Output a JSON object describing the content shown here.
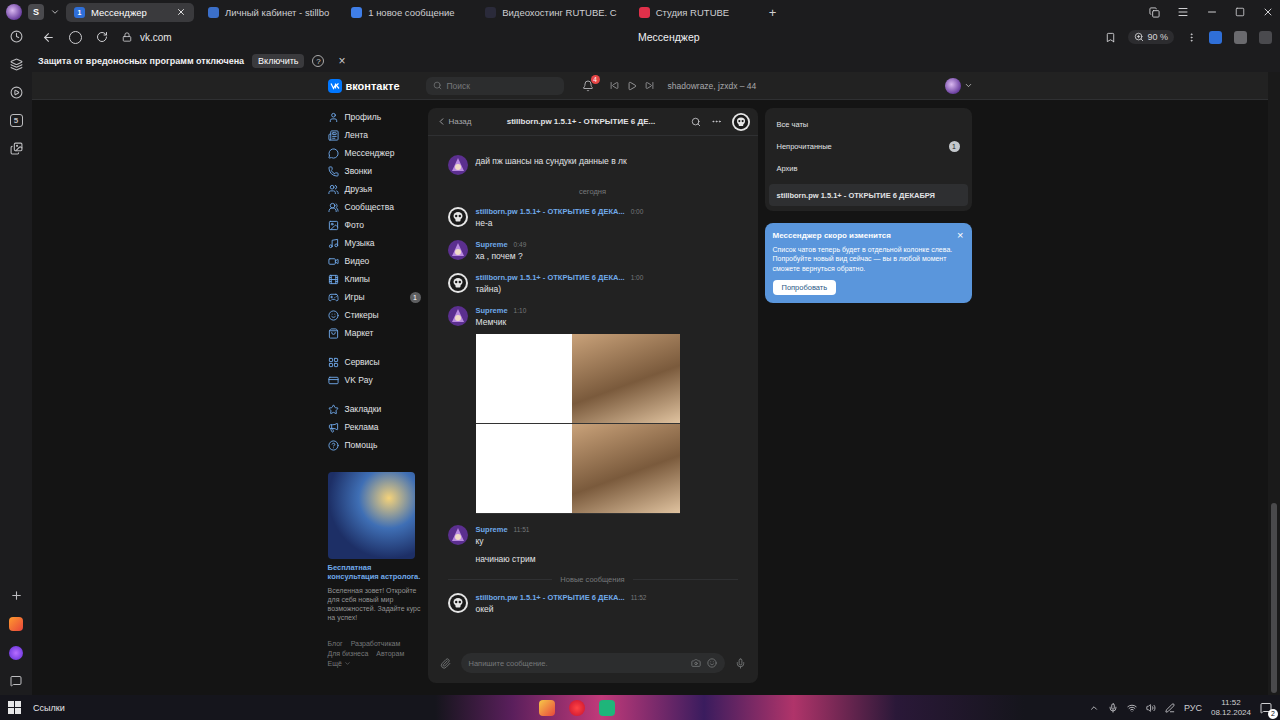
{
  "browser": {
    "profile": "S",
    "tabs": [
      {
        "label": "Мессенджер",
        "badge": "1",
        "color": "#2f6fd8",
        "selected": true
      },
      {
        "label": "Личный кабинет - stillbo",
        "badge": "",
        "color": "#3b6fc9",
        "selected": false
      },
      {
        "label": "1 новое сообщение",
        "badge": "",
        "color": "#3f7ee8",
        "selected": false
      },
      {
        "label": "Видеохостинг RUTUBE. С",
        "badge": "",
        "color": "#2a2a3a",
        "selected": false
      },
      {
        "label": "Студия RUTUBE",
        "badge": "",
        "color": "#e0304a",
        "selected": false
      }
    ],
    "new_tab": "+",
    "address": "vk.com",
    "page_title": "Мессенджер",
    "zoom": "90 %",
    "sidebar_app": "5",
    "infobar": {
      "text": "Защита от вредоносных программ отключена",
      "button": "Включить",
      "help": "?",
      "close": "×"
    }
  },
  "vk": {
    "logo": "вконтакте",
    "search": "Поиск",
    "notifications": "4",
    "user": "shadowraze, jzxdx – 44"
  },
  "nav": {
    "groups": [
      [
        {
          "label": "Профиль",
          "badge": ""
        },
        {
          "label": "Лента",
          "badge": ""
        },
        {
          "label": "Мессенджер",
          "badge": ""
        },
        {
          "label": "Звонки",
          "badge": ""
        },
        {
          "label": "Друзья",
          "badge": ""
        },
        {
          "label": "Сообщества",
          "badge": ""
        },
        {
          "label": "Фото",
          "badge": ""
        },
        {
          "label": "Музыка",
          "badge": ""
        },
        {
          "label": "Видео",
          "badge": ""
        },
        {
          "label": "Клипы",
          "badge": ""
        },
        {
          "label": "Игры",
          "badge": "1"
        },
        {
          "label": "Стикеры",
          "badge": ""
        },
        {
          "label": "Маркет",
          "badge": ""
        }
      ],
      [
        {
          "label": "Сервисы",
          "badge": ""
        },
        {
          "label": "VK Pay",
          "badge": ""
        }
      ],
      [
        {
          "label": "Закладки",
          "badge": ""
        },
        {
          "label": "Реклама",
          "badge": ""
        },
        {
          "label": "Помощь",
          "badge": ""
        }
      ]
    ],
    "ad": {
      "title": "Бесплатная консультация астролога.",
      "text": "Вселенная зовет! Откройте для себя новый мир возможностей. Задайте курс на успех!"
    },
    "footer": [
      "Блог",
      "Разработчикам",
      "Для бизнеса",
      "Авторам"
    ],
    "more": "Ещё"
  },
  "chat": {
    "back": "Назад",
    "title": "stillborn.pw 1.5.1+ - ОТКРЫТИЕ 6 ДЕ...",
    "input": "Напишите сообщение.",
    "items": [
      {
        "kind": "tail",
        "from": "user",
        "author": "",
        "time": "",
        "lines": [
          "дай пж шансы на сундуки данные в лк"
        ],
        "image": false
      },
      {
        "kind": "date",
        "text": "сегодня"
      },
      {
        "kind": "message",
        "from": "community",
        "author": "stillborn.pw 1.5.1+ - ОТКРЫТИЕ 6 ДЕКА...",
        "time": "0:00",
        "lines": [
          "не-а"
        ],
        "image": false
      },
      {
        "kind": "message",
        "from": "user",
        "author": "Supreme",
        "time": "0:49",
        "lines": [
          "ха , почем ?"
        ],
        "image": false
      },
      {
        "kind": "message",
        "from": "community",
        "author": "stillborn.pw 1.5.1+ - ОТКРЫТИЕ 6 ДЕКА...",
        "time": "1:00",
        "lines": [
          "тайна)"
        ],
        "image": false
      },
      {
        "kind": "message",
        "from": "user",
        "author": "Supreme",
        "time": "1:10",
        "lines": [
          "Мемчик"
        ],
        "image": true
      },
      {
        "kind": "message",
        "from": "user",
        "author": "Supreme",
        "time": "11:51",
        "lines": [
          "ку",
          "начинаю стрим"
        ],
        "image": false
      },
      {
        "kind": "divider",
        "text": "Новые сообщения"
      },
      {
        "kind": "message",
        "from": "community",
        "author": "stillborn.pw 1.5.1+ - ОТКРЫТИЕ 6 ДЕКА...",
        "time": "11:52",
        "lines": [
          "окей"
        ],
        "image": false
      }
    ]
  },
  "folders": [
    {
      "label": "Все чаты",
      "badge": "",
      "selected": false
    },
    {
      "label": "Непрочитанные",
      "badge": "1",
      "selected": false
    },
    {
      "label": "Архив",
      "badge": "",
      "selected": false
    }
  ],
  "chats": [
    {
      "label": "stillborn.pw 1.5.1+ - ОТКРЫТИЕ 6 ДЕКАБРЯ",
      "selected": true
    }
  ],
  "promo": {
    "title": "Мессенджер скоро изменится",
    "text": "Список чатов теперь будет в отдельной колонке слева. Попробуйте новый вид сейчас — вы в любой момент сможете вернуться обратно.",
    "button": "Попробовать",
    "close": "×"
  },
  "taskbar": {
    "links": "Ссылки",
    "lang": "РУС",
    "time": "11:52",
    "date": "08.12.2024",
    "notifications": "2"
  }
}
